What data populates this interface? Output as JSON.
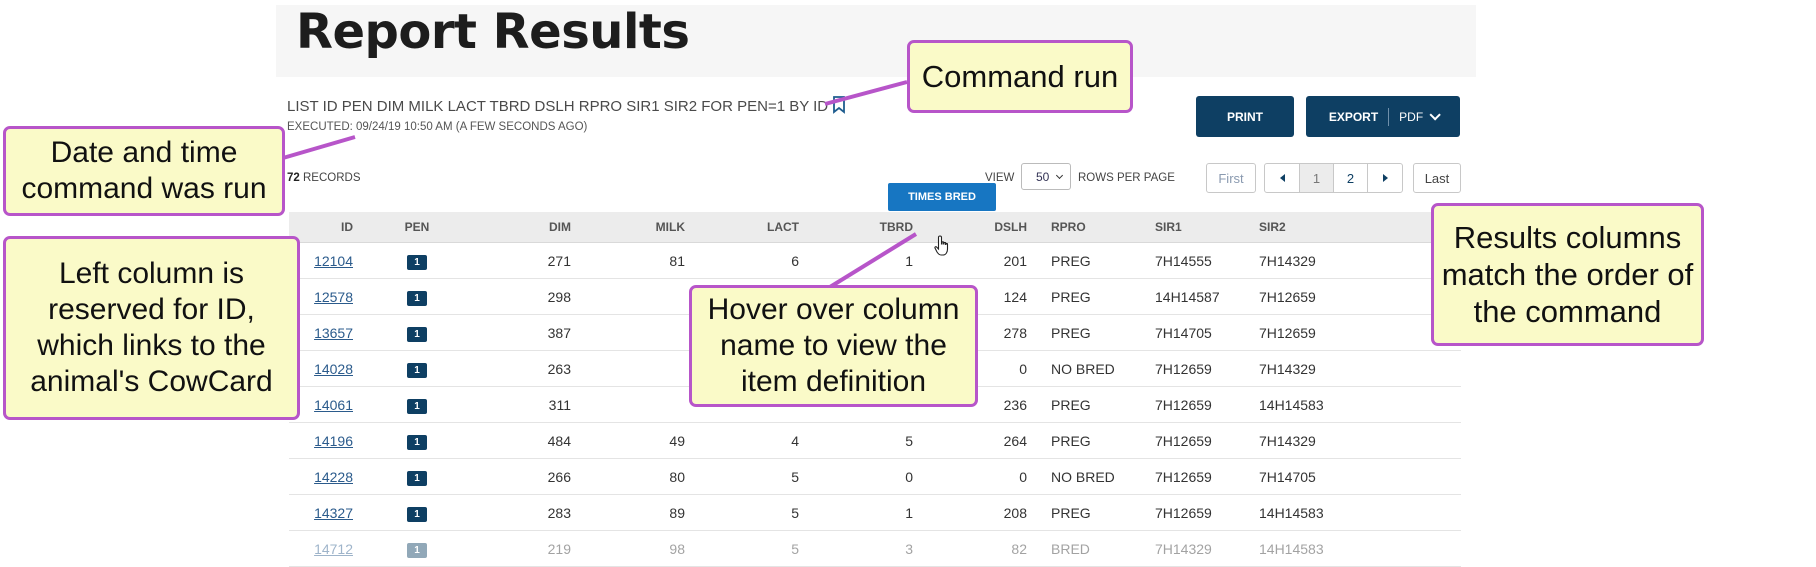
{
  "page_title": "Report Results",
  "command": "LIST ID PEN DIM MILK LACT TBRD DSLH RPRO SIR1 SIR2 FOR PEN=1 BY ID",
  "executed": "EXECUTED: 09/24/19 10:50 AM (A FEW SECONDS AGO)",
  "toolbar": {
    "print_label": "PRINT",
    "export_label": "EXPORT",
    "export_format": "PDF"
  },
  "records": {
    "count": "72",
    "label": "RECORDS"
  },
  "view": {
    "label": "VIEW",
    "rows_per_page": "50",
    "rows_label": "ROWS PER PAGE"
  },
  "pagination": {
    "first": "First",
    "page1": "1",
    "page2": "2",
    "last": "Last"
  },
  "tooltip": "TIMES BRED",
  "columns": [
    "ID",
    "PEN",
    "DIM",
    "MILK",
    "LACT",
    "TBRD",
    "DSLH",
    "RPRO",
    "SIR1",
    "SIR2"
  ],
  "rows": [
    {
      "id": "12104",
      "pen": "1",
      "dim": "271",
      "milk": "81",
      "lact": "6",
      "tbrd": "1",
      "dslh": "201",
      "rpro": "PREG",
      "sir1": "7H14555",
      "sir2": "7H14329"
    },
    {
      "id": "12578",
      "pen": "1",
      "dim": "298",
      "milk": "",
      "lact": "",
      "tbrd": "",
      "dslh": "124",
      "rpro": "PREG",
      "sir1": "14H14587",
      "sir2": "7H12659"
    },
    {
      "id": "13657",
      "pen": "1",
      "dim": "387",
      "milk": "",
      "lact": "",
      "tbrd": "",
      "dslh": "278",
      "rpro": "PREG",
      "sir1": "7H14705",
      "sir2": "7H12659"
    },
    {
      "id": "14028",
      "pen": "1",
      "dim": "263",
      "milk": "",
      "lact": "",
      "tbrd": "",
      "dslh": "0",
      "rpro": "NO BRED",
      "sir1": "7H12659",
      "sir2": "7H14329"
    },
    {
      "id": "14061",
      "pen": "1",
      "dim": "311",
      "milk": "",
      "lact": "",
      "tbrd": "",
      "dslh": "236",
      "rpro": "PREG",
      "sir1": "7H12659",
      "sir2": "14H14583"
    },
    {
      "id": "14196",
      "pen": "1",
      "dim": "484",
      "milk": "49",
      "lact": "4",
      "tbrd": "5",
      "dslh": "264",
      "rpro": "PREG",
      "sir1": "7H12659",
      "sir2": "7H14329"
    },
    {
      "id": "14228",
      "pen": "1",
      "dim": "266",
      "milk": "80",
      "lact": "5",
      "tbrd": "0",
      "dslh": "0",
      "rpro": "NO BRED",
      "sir1": "7H12659",
      "sir2": "7H14705"
    },
    {
      "id": "14327",
      "pen": "1",
      "dim": "283",
      "milk": "89",
      "lact": "5",
      "tbrd": "1",
      "dslh": "208",
      "rpro": "PREG",
      "sir1": "7H12659",
      "sir2": "14H14583"
    },
    {
      "id": "14712",
      "pen": "1",
      "dim": "219",
      "milk": "98",
      "lact": "5",
      "tbrd": "3",
      "dslh": "82",
      "rpro": "BRED",
      "sir1": "7H14329",
      "sir2": "14H14583"
    }
  ],
  "callouts": {
    "command_run": "Command run",
    "date_time": "Date and time command was run",
    "left_column": "Left column is reserved for ID, which links to the animal's CowCard",
    "hover": "Hover over column name to view the item definition",
    "results_columns": "Results columns match the order of the command"
  },
  "colors": {
    "brand_navy": "#0e3f63",
    "tooltip_blue": "#1776c2",
    "callout_fill": "#fafac8",
    "callout_border": "#b755c9"
  },
  "icons": {
    "bookmark": "bookmark-icon",
    "cursor": "hand-pointer-icon",
    "prev": "caret-left-icon",
    "next": "caret-right-icon"
  }
}
